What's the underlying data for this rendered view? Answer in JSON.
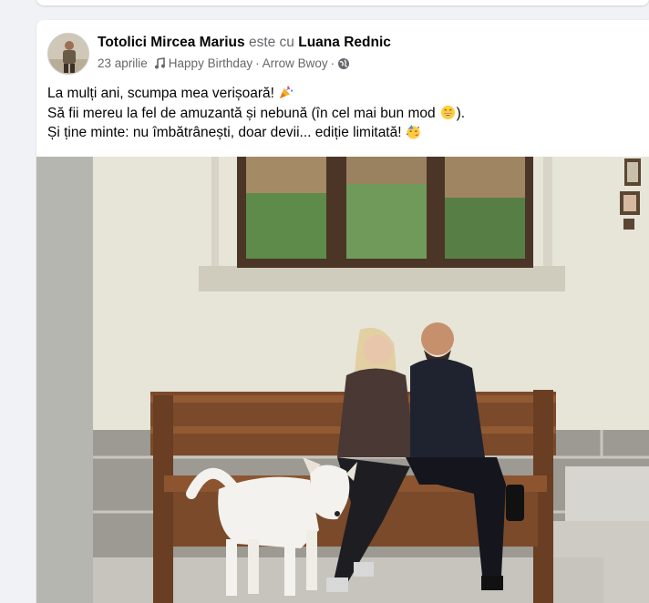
{
  "post": {
    "author": "Totolici Mircea Marius",
    "with_text": "este cu",
    "tagged": "Luana Rednic",
    "date": "23 aprilie",
    "music_title": "Happy Birthday",
    "music_artist": "Arrow Bwoy",
    "separator": "·",
    "audience_icon": "globe-icon",
    "lines": [
      "La mulți ani,  scumpa mea verișoară!",
      "Să fii mereu la fel de amuzantă și nebună (în cel mai bun mod",
      ").",
      "Și ține minte: nu îmbătrânești, doar devii... ediție limitată!"
    ],
    "emojis": [
      "party-popper-icon",
      "grinning-face-icon",
      "partying-face-icon"
    ]
  },
  "photo": {
    "description_icon": "post-photo",
    "colors": {
      "wall": "#e7e4d8",
      "bench": "#7a4a2a",
      "dog": "#f4f2ee",
      "frame": "#4a3526"
    }
  }
}
